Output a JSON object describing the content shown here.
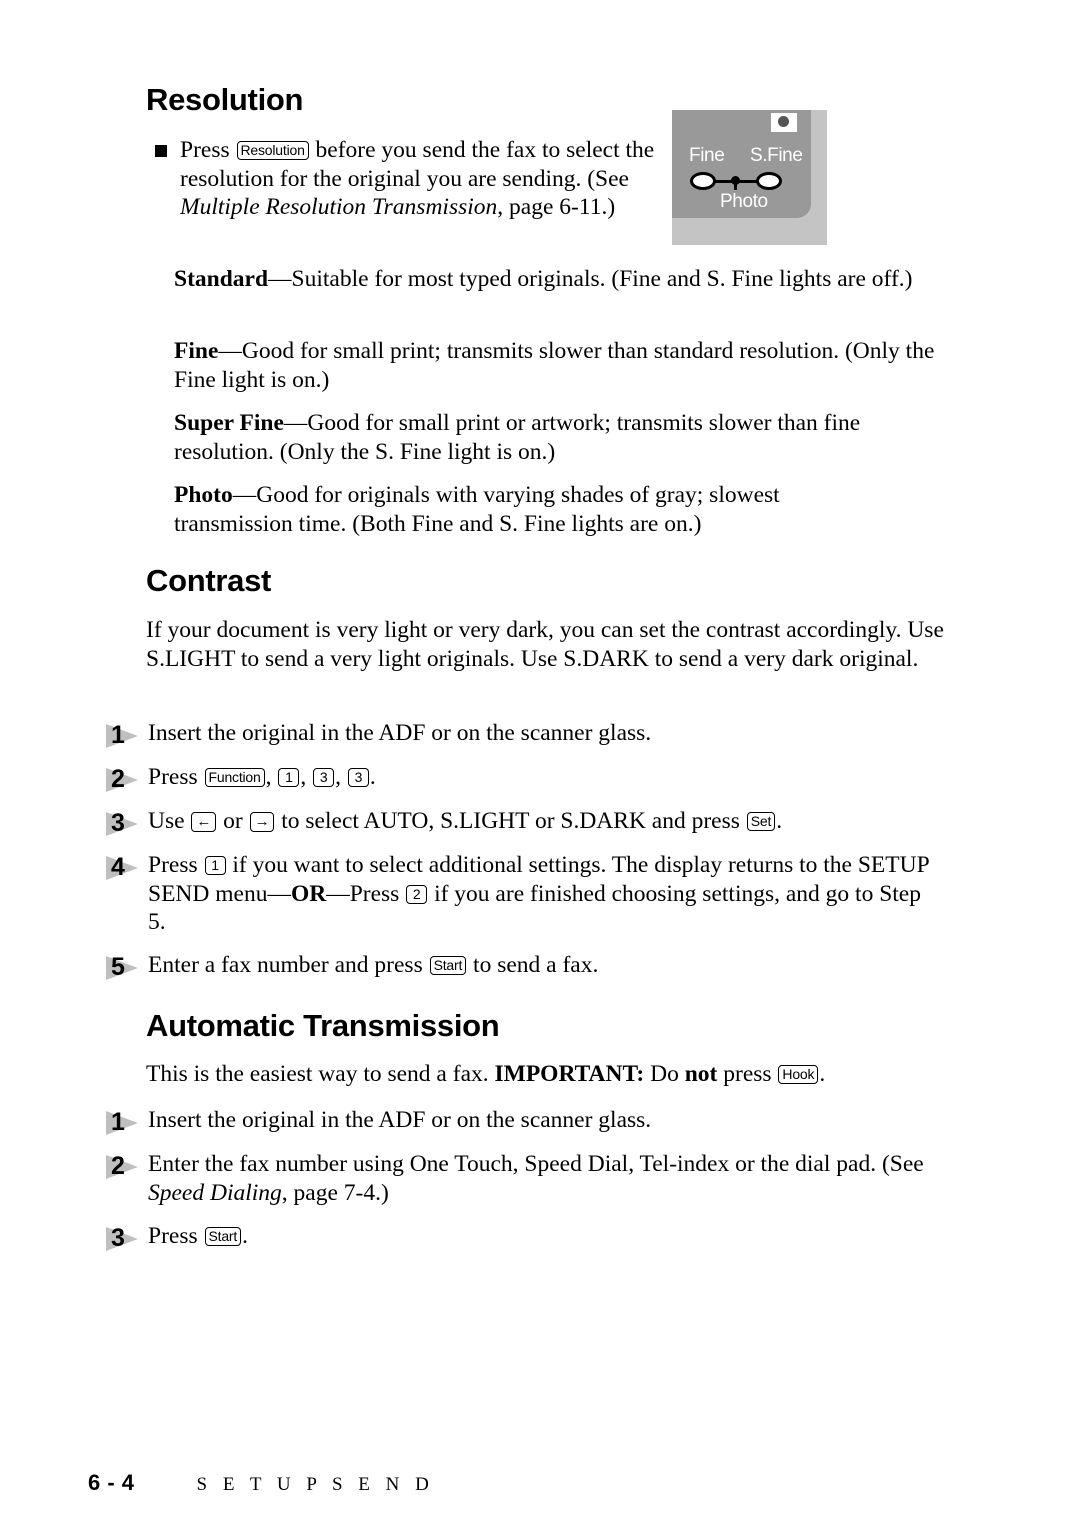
{
  "page": {
    "footer_folio": "6 - 4",
    "footer_runhead": "S E T U P   S E N D"
  },
  "resolution_section": {
    "title": "Resolution",
    "bullet": {
      "before_key": "Press",
      "key_label": "Resolution",
      "after_key": "before you send the fax to select the resolution for the original you are sending. (See",
      "italic_ref": "Multiple  Resolution Transmission",
      "tail": ", page 6-11.)"
    },
    "definitions": [
      {
        "term": "Standard",
        "text": "—Suitable for most typed originals. (Fine and S. Fine lights are off.)"
      },
      {
        "term": "Fine",
        "text": "—Good for small print; transmits slower than standard resolution. (Only the Fine light is on.)"
      },
      {
        "term": "Super Fine",
        "text": "—Good for small print or artwork; transmits slower than fine resolution. (Only the S. Fine light is on.)"
      },
      {
        "term": "Photo",
        "text": "—Good for originals with varying shades of gray; slowest transmission time. (Both Fine and S. Fine lights are on.)"
      }
    ],
    "illustration": {
      "label_fine": "Fine",
      "label_sfine": "S.Fine",
      "label_photo": "Photo",
      "panel_color": "#999999",
      "background_color": "#c4c4c4",
      "label_color": "#ffffff"
    }
  },
  "contrast_section": {
    "title": "Contrast",
    "intro": "If your document is very light or very dark, you can set the contrast accordingly. Use S.LIGHT to send a very light originals. Use S.DARK to send a very dark original.",
    "steps": [
      {
        "num": "1",
        "parts": [
          {
            "t": "text",
            "v": "Insert the original in the ADF or on the scanner glass."
          }
        ]
      },
      {
        "num": "2",
        "parts": [
          {
            "t": "text",
            "v": "Press "
          },
          {
            "t": "key",
            "v": "Function"
          },
          {
            "t": "text",
            "v": ", "
          },
          {
            "t": "key",
            "v": "1"
          },
          {
            "t": "text",
            "v": ", "
          },
          {
            "t": "key",
            "v": "3"
          },
          {
            "t": "text",
            "v": ", "
          },
          {
            "t": "key",
            "v": "3"
          },
          {
            "t": "text",
            "v": "."
          }
        ]
      },
      {
        "num": "3",
        "parts": [
          {
            "t": "text",
            "v": "Use "
          },
          {
            "t": "key-arrow",
            "v": "←"
          },
          {
            "t": "text",
            "v": " or "
          },
          {
            "t": "key-arrow",
            "v": "→"
          },
          {
            "t": "text",
            "v": " to select AUTO, S.LIGHT or S.DARK and press "
          },
          {
            "t": "key",
            "v": "Set"
          },
          {
            "t": "text",
            "v": "."
          }
        ]
      },
      {
        "num": "4",
        "parts": [
          {
            "t": "text",
            "v": "Press "
          },
          {
            "t": "key",
            "v": "1"
          },
          {
            "t": "text",
            "v": " if you want to select additional settings. The display returns to the SETUP SEND menu—"
          },
          {
            "t": "bold",
            "v": "OR"
          },
          {
            "t": "text",
            "v": "—Press "
          },
          {
            "t": "key",
            "v": "2"
          },
          {
            "t": "text",
            "v": " if you are finished choosing settings, and go to Step 5."
          }
        ]
      },
      {
        "num": "5",
        "parts": [
          {
            "t": "text",
            "v": "Enter a fax number and press "
          },
          {
            "t": "key",
            "v": "Start"
          },
          {
            "t": "text",
            "v": " to send a fax."
          }
        ]
      }
    ]
  },
  "automatic_transmission_section": {
    "title": "Automatic Transmission",
    "intro_parts": [
      {
        "t": "text",
        "v": "This is the easiest way to send a fax. "
      },
      {
        "t": "bold",
        "v": "IMPORTANT:"
      },
      {
        "t": "text",
        "v": "  Do "
      },
      {
        "t": "bold",
        "v": "not"
      },
      {
        "t": "text",
        "v": " press "
      },
      {
        "t": "key",
        "v": "Hook"
      },
      {
        "t": "text",
        "v": "."
      }
    ],
    "steps": [
      {
        "num": "1",
        "parts": [
          {
            "t": "text",
            "v": "Insert the original in the ADF or on the scanner glass."
          }
        ]
      },
      {
        "num": "2",
        "parts": [
          {
            "t": "text",
            "v": "Enter the fax number using One Touch, Speed Dial, Tel-index or the dial pad. (See "
          },
          {
            "t": "italic",
            "v": "Speed Dialing"
          },
          {
            "t": "text",
            "v": ", page 7-4.)"
          }
        ]
      },
      {
        "num": "3",
        "parts": [
          {
            "t": "text",
            "v": "Press "
          },
          {
            "t": "key",
            "v": "Start"
          },
          {
            "t": "text",
            "v": "."
          }
        ]
      }
    ]
  }
}
